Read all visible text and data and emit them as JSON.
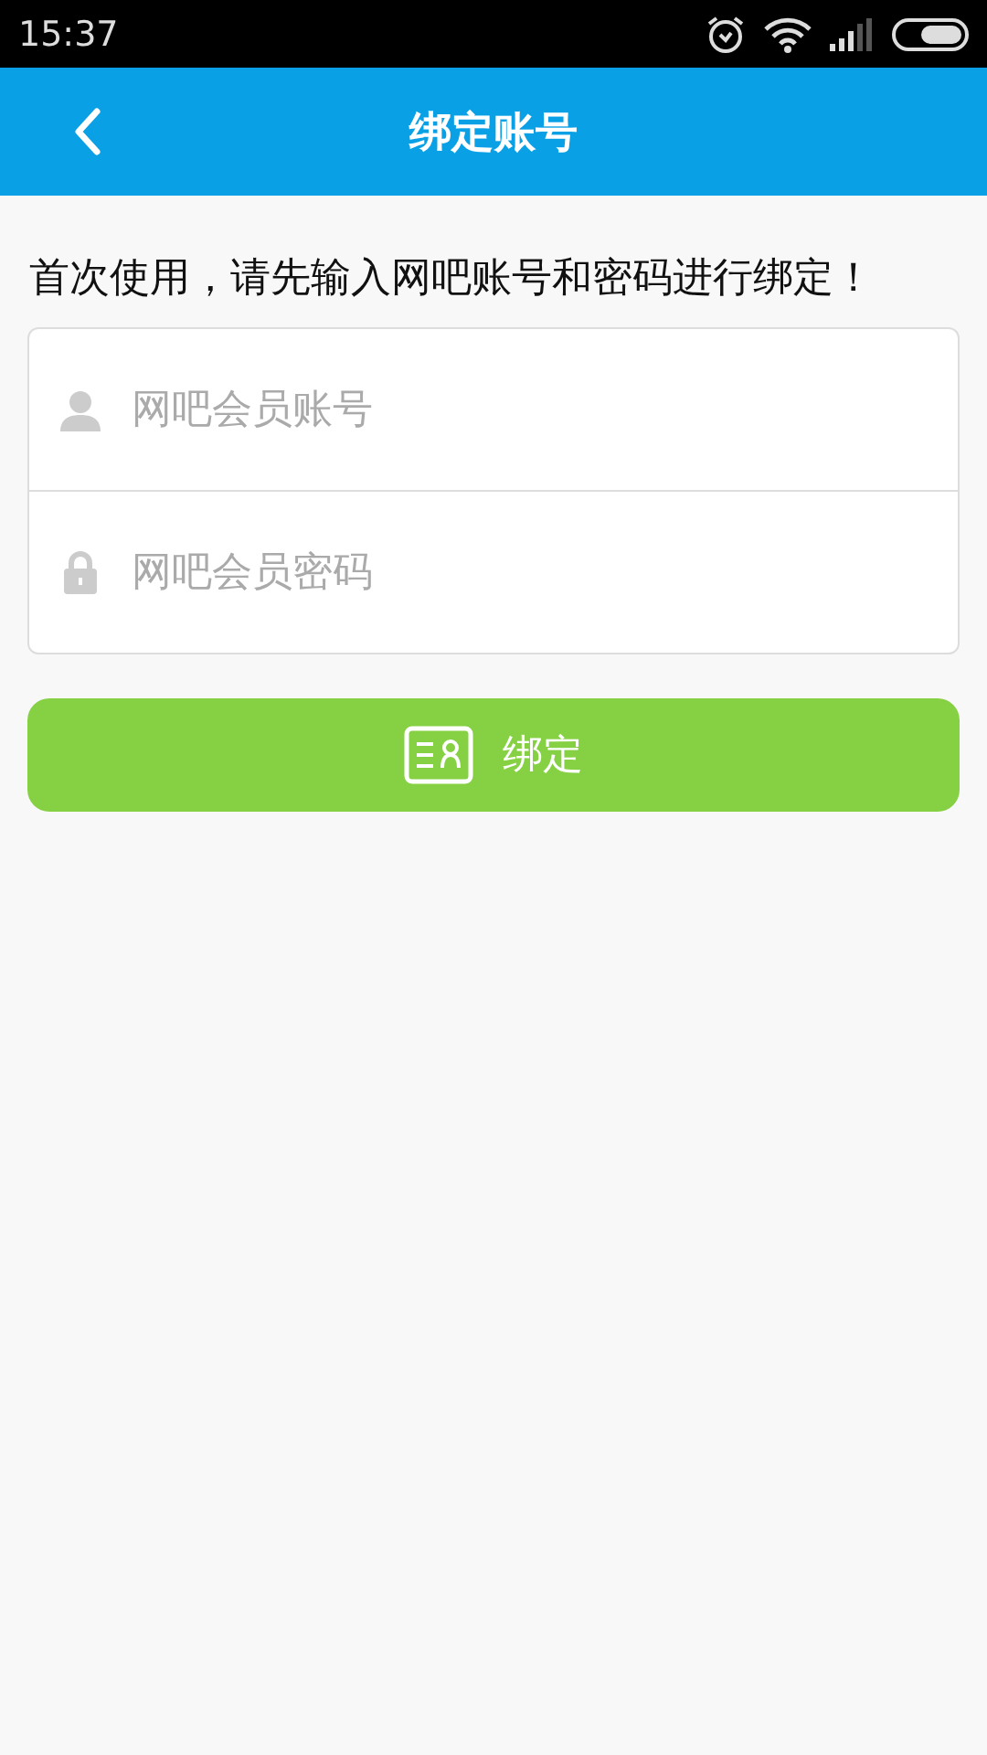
{
  "status_bar": {
    "time": "15:37"
  },
  "header": {
    "title": "绑定账号"
  },
  "instruction": "首次使用，请先输入网吧账号和密码进行绑定！",
  "fields": [
    {
      "kind": "account",
      "placeholder": "网吧会员账号"
    },
    {
      "kind": "password",
      "placeholder": "网吧会员密码"
    }
  ],
  "bind_button": {
    "label": "绑定"
  }
}
